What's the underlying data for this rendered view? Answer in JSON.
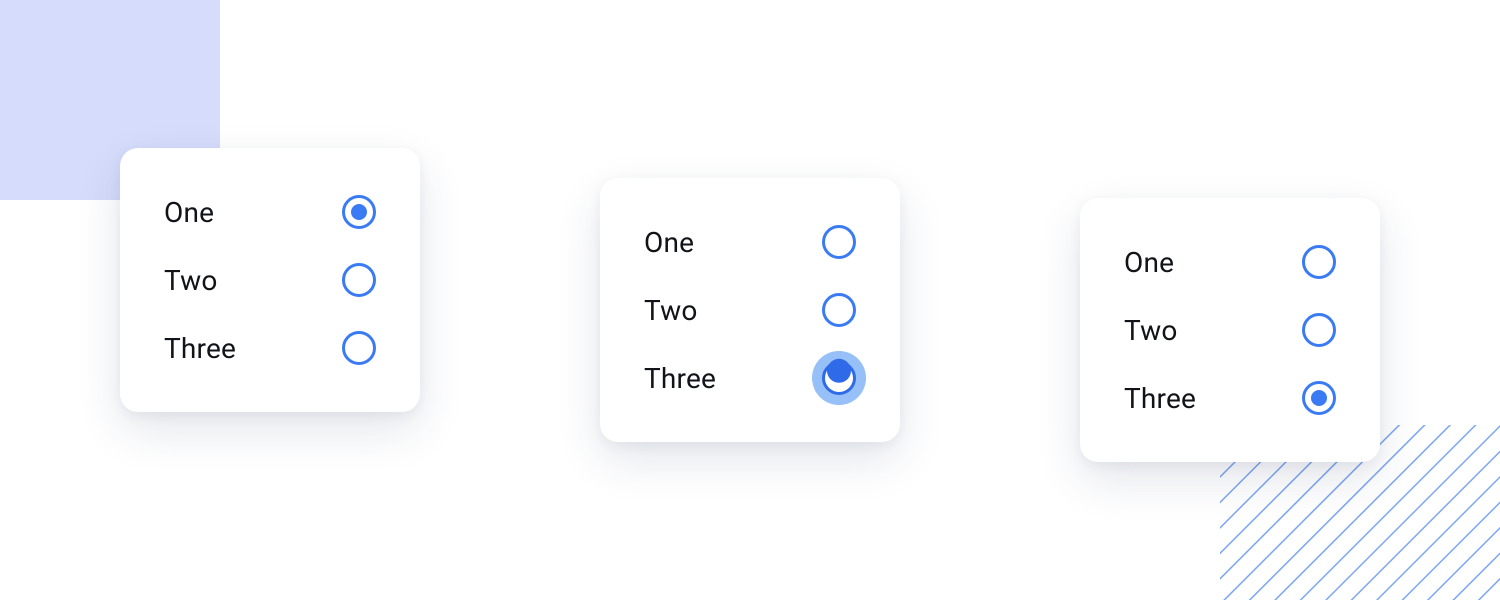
{
  "options": {
    "one": "One",
    "two": "Two",
    "three": "Three"
  },
  "groups": [
    {
      "id": "group-a",
      "items": [
        {
          "key": "one",
          "state": "selected"
        },
        {
          "key": "two",
          "state": "unselected"
        },
        {
          "key": "three",
          "state": "unselected"
        }
      ]
    },
    {
      "id": "group-b",
      "items": [
        {
          "key": "one",
          "state": "unselected"
        },
        {
          "key": "two",
          "state": "unselected"
        },
        {
          "key": "three",
          "state": "pressed"
        }
      ]
    },
    {
      "id": "group-c",
      "items": [
        {
          "key": "one",
          "state": "unselected"
        },
        {
          "key": "two",
          "state": "unselected"
        },
        {
          "key": "three",
          "state": "selected"
        }
      ]
    }
  ],
  "colors": {
    "accent": "#3a7bf4",
    "halo": "#96c0f7",
    "bg_square": "#d6dcfb",
    "stripe": "#7ca6f2"
  }
}
